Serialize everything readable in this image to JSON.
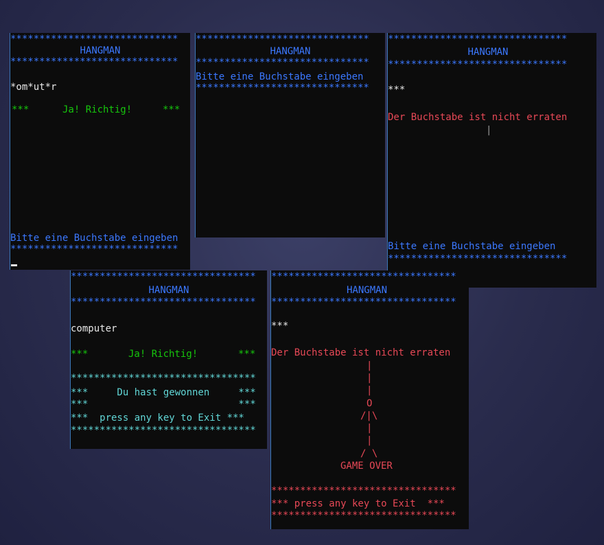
{
  "stars": {
    "s29": "*****************************",
    "s30": "******************************",
    "s32": "********************************",
    "s31": "*******************************"
  },
  "common": {
    "title": "HANGMAN",
    "prompt": "Bitte eine Buchstabe eingeben",
    "wrong": "Der Buchstabe ist nicht erraten",
    "correct_left": "***",
    "correct_text": "Ja! Richtig!",
    "correct_right": "***",
    "masked_three": "***"
  },
  "w1": {
    "word": "*om*ut*r"
  },
  "w3": {
    "gallows_top": "|"
  },
  "w4": {
    "word": "computer",
    "won": "***     Du hast gewonnen     ***",
    "blank": "***                          ***",
    "exit": "***  press any key to Exit ***"
  },
  "w5": {
    "hang_lines": [
      "|",
      "|",
      "|",
      "|",
      "O",
      "/|\\",
      "|",
      "|",
      "/ \\"
    ],
    "game_over": "GAME OVER",
    "exit": "*** press any key to Exit  ***"
  },
  "colors": {
    "console_bg": "#0c0c0c",
    "blue": "#3b78ff",
    "green": "#16c60c",
    "red": "#e74856",
    "cyan": "#61d6d6",
    "white": "#e8e8e8"
  }
}
